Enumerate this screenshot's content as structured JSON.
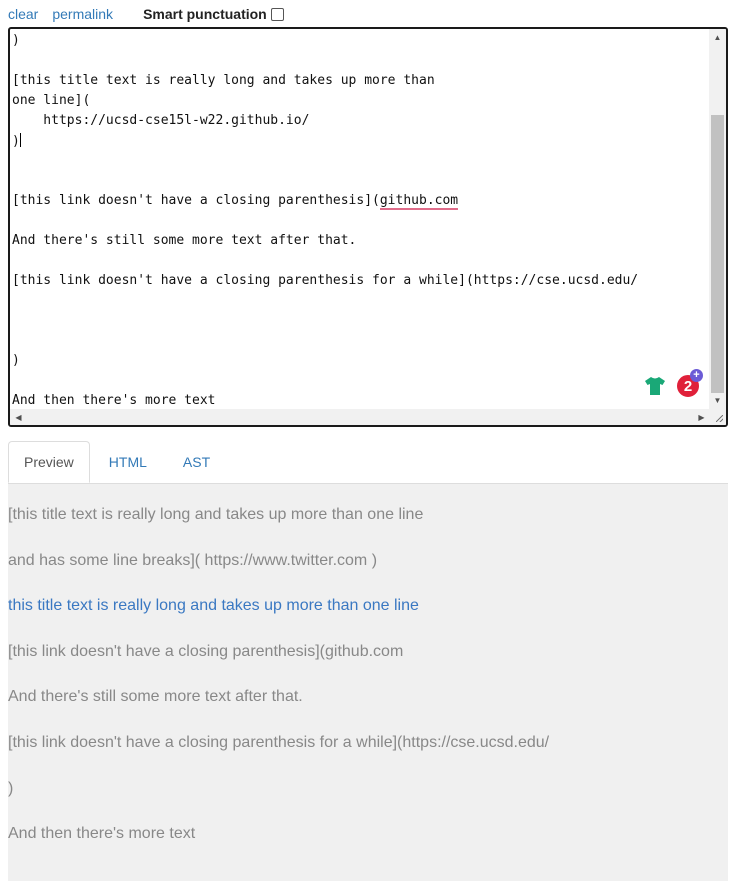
{
  "toolbar": {
    "clear_label": "clear",
    "permalink_label": "permalink",
    "smart_punctuation_label": "Smart punctuation",
    "smart_punctuation_checked": false
  },
  "editor": {
    "lines": [
      ")",
      "",
      "[this title text is really long and takes up more than",
      "one line](",
      "    https://ucsd-cse15l-w22.github.io/",
      ")",
      "",
      "",
      "[this link doesn't have a closing parenthesis](",
      "github.com",
      "",
      "And there's still some more text after that.",
      "",
      "[this link doesn't have a closing parenthesis for a while](https://cse.ucsd.edu/",
      "",
      "",
      "",
      ")",
      "",
      "And then there's more text"
    ],
    "badge_count": "2",
    "badge_plus": "+"
  },
  "tabs": [
    {
      "label": "Preview",
      "active": true
    },
    {
      "label": "HTML",
      "active": false
    },
    {
      "label": "AST",
      "active": false
    }
  ],
  "preview": {
    "p1": "[this title text is really long and takes up more than one line",
    "p2": "and has some line breaks]( https://www.twitter.com )",
    "p3_link": "this title text is really long and takes up more than one line",
    "p4": "[this link doesn't have a closing parenthesis](github.com",
    "p5": "And there's still some more text after that.",
    "p6": "[this link doesn't have a closing parenthesis for a while](https://cse.ucsd.edu/",
    "p7": ")",
    "p8": "And then there's more text"
  },
  "colors": {
    "link": "#337ab7",
    "preview_bg": "#f0f0f0",
    "preview_text": "#888888",
    "badge": "#e0203a",
    "spellcheck_underline": "#e06c8a"
  }
}
